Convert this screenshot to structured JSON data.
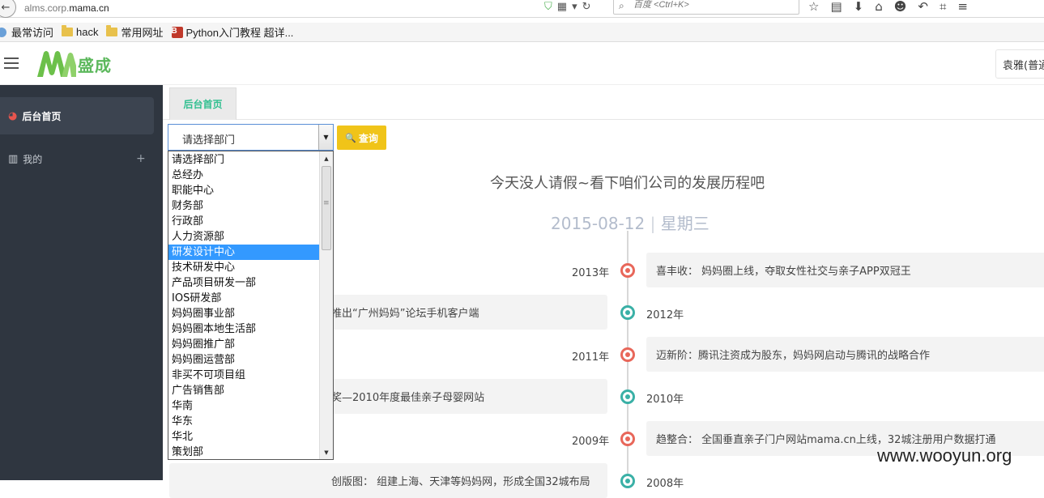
{
  "browser": {
    "url_prefix": "alms.corp.",
    "url_domain": "mama.cn",
    "search_placeholder": "百度 <Ctrl+K>",
    "bookmarks": [
      {
        "label": "最常访问",
        "icon": "globe-icon"
      },
      {
        "label": "hack",
        "icon": "folder-icon"
      },
      {
        "label": "常用网址",
        "icon": "folder-icon"
      },
      {
        "label": "Python入门教程 超详...",
        "icon": "b3-icon"
      }
    ]
  },
  "header": {
    "logo_text": "盛成",
    "user_label": "袁雅(普通",
    "brand_color": "#5cb85c"
  },
  "sidebar": {
    "items": [
      {
        "label": "后台首页",
        "icon": "dashboard-icon"
      },
      {
        "label": "我的",
        "icon": "bar-chart-icon",
        "expand": "+"
      }
    ]
  },
  "main": {
    "tab_label": "后台首页",
    "select_value": "请选择部门",
    "query_label": "查询",
    "departments": [
      "请选择部门",
      "总经办",
      "职能中心",
      "财务部",
      "行政部",
      "人力资源部",
      "研发设计中心",
      "技术研发中心",
      "产品项目研发一部",
      "IOS研发部",
      "妈妈圈事业部",
      "妈妈圈本地生活部",
      "妈妈圈推广部",
      "妈妈圈运营部",
      "非买不可项目组",
      "广告销售部",
      "华南",
      "华东",
      "华北",
      "策划部"
    ],
    "selected_department": "研发设计中心",
    "headline": "今天没人请假~看下咱们公司的发展历程吧",
    "date": "2015-08-12",
    "date_sep": "|",
    "weekday": "星期三"
  },
  "timeline": [
    {
      "year": "2013年",
      "side": "right",
      "text": "喜丰收： 妈妈圈上线，夺取女性社交与亲子APP双冠王",
      "color": "#e8675a"
    },
    {
      "year": "2012年",
      "side": "left",
      "text": "推出“广州妈妈”论坛手机客户端",
      "color": "#3ab0a6"
    },
    {
      "year": "2011年",
      "side": "right",
      "text": "迈新阶：腾讯注资成为股东，妈妈网启动与腾讯的战略合作",
      "color": "#e8675a"
    },
    {
      "year": "2010年",
      "side": "left",
      "text": "奖—2010年度最佳亲子母婴网站",
      "color": "#3ab0a6"
    },
    {
      "year": "2009年",
      "side": "right",
      "text": "趋整合： 全国垂直亲子门户网站mama.cn上线，32城注册用户数据打通",
      "color": "#e8675a"
    },
    {
      "year": "2008年",
      "side": "left",
      "text": "创版图： 组建上海、天津等妈妈网，形成全国32城布局",
      "color": "#3ab0a6"
    }
  ],
  "watermark": "www.wooyun.org"
}
